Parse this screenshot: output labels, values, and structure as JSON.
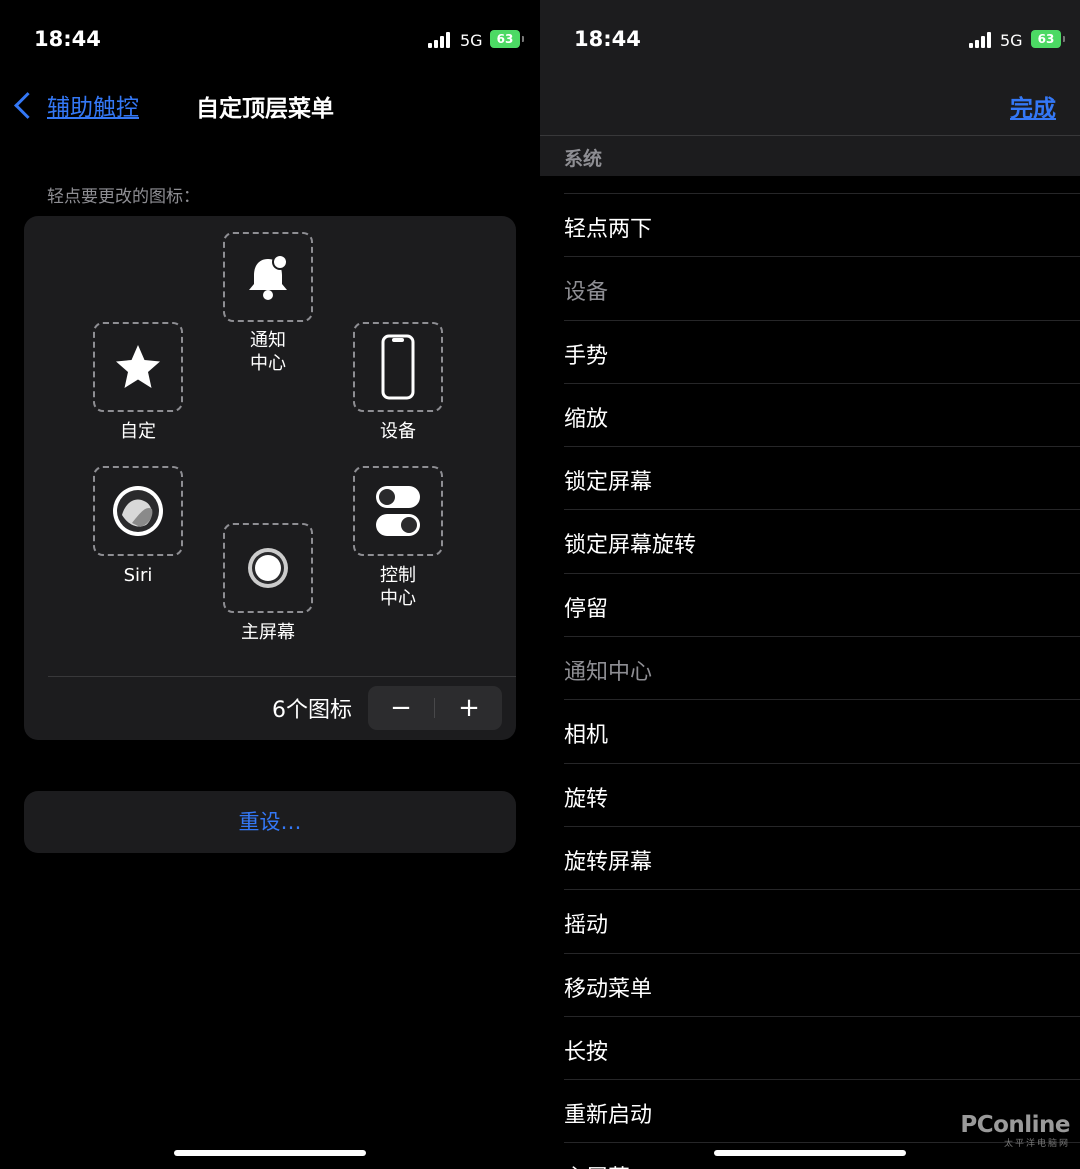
{
  "status_bar": {
    "time": "18:44",
    "network": "5G",
    "battery": "63"
  },
  "left": {
    "back_label": "辅助触控",
    "title": "自定顶层菜单",
    "hint": "轻点要更改的图标：",
    "slots": {
      "notification": "通知\n中心",
      "custom": "自定",
      "device": "设备",
      "siri": "Siri",
      "control": "控制\n中心",
      "home": "主屏幕"
    },
    "icon_count": "6个图标",
    "minus": "−",
    "plus": "+",
    "reset": "重设…"
  },
  "right": {
    "done": "完成",
    "section": "系统",
    "items": [
      {
        "label": "轻点两下",
        "enabled": true
      },
      {
        "label": "设备",
        "enabled": false
      },
      {
        "label": "手势",
        "enabled": true
      },
      {
        "label": "缩放",
        "enabled": true
      },
      {
        "label": "锁定屏幕",
        "enabled": true
      },
      {
        "label": "锁定屏幕旋转",
        "enabled": true
      },
      {
        "label": "停留",
        "enabled": true
      },
      {
        "label": "通知中心",
        "enabled": false
      },
      {
        "label": "相机",
        "enabled": true
      },
      {
        "label": "旋转",
        "enabled": true
      },
      {
        "label": "旋转屏幕",
        "enabled": true
      },
      {
        "label": "摇动",
        "enabled": true
      },
      {
        "label": "移动菜单",
        "enabled": true
      },
      {
        "label": "长按",
        "enabled": true
      },
      {
        "label": "重新启动",
        "enabled": true
      },
      {
        "label": "主屏幕",
        "enabled": true
      }
    ]
  },
  "watermark": {
    "main": "PConline",
    "sub": "太平洋电脑网"
  }
}
